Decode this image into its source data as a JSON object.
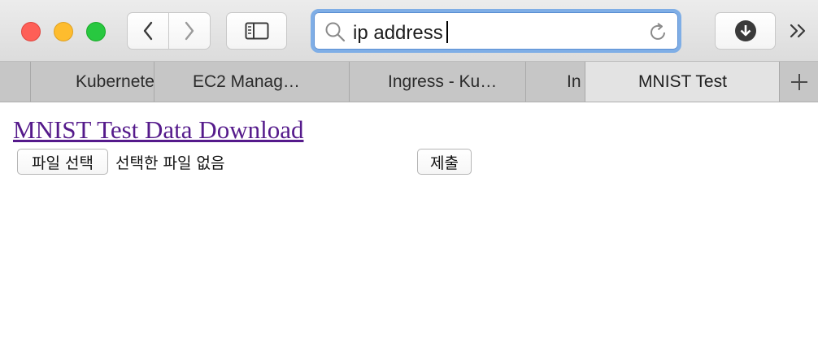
{
  "toolbar": {
    "address_text": "ip address"
  },
  "tabs": [
    {
      "label": "Kubernetes",
      "active": false
    },
    {
      "label": "EC2 Manag…",
      "active": false
    },
    {
      "label": "Ingress - Ku…",
      "active": false
    },
    {
      "label": "In",
      "active": false
    },
    {
      "label": "MNIST Test",
      "active": true
    }
  ],
  "page": {
    "link_text": "MNIST Test Data Download",
    "file_button_label": "파일 선택",
    "file_status": "선택한 파일 없음",
    "submit_label": "제출"
  },
  "colors": {
    "link_visited": "#551a8b",
    "focus_ring": "#7faee6",
    "close": "#fe5f57",
    "minimize": "#febc2e",
    "maximize": "#28c840"
  }
}
